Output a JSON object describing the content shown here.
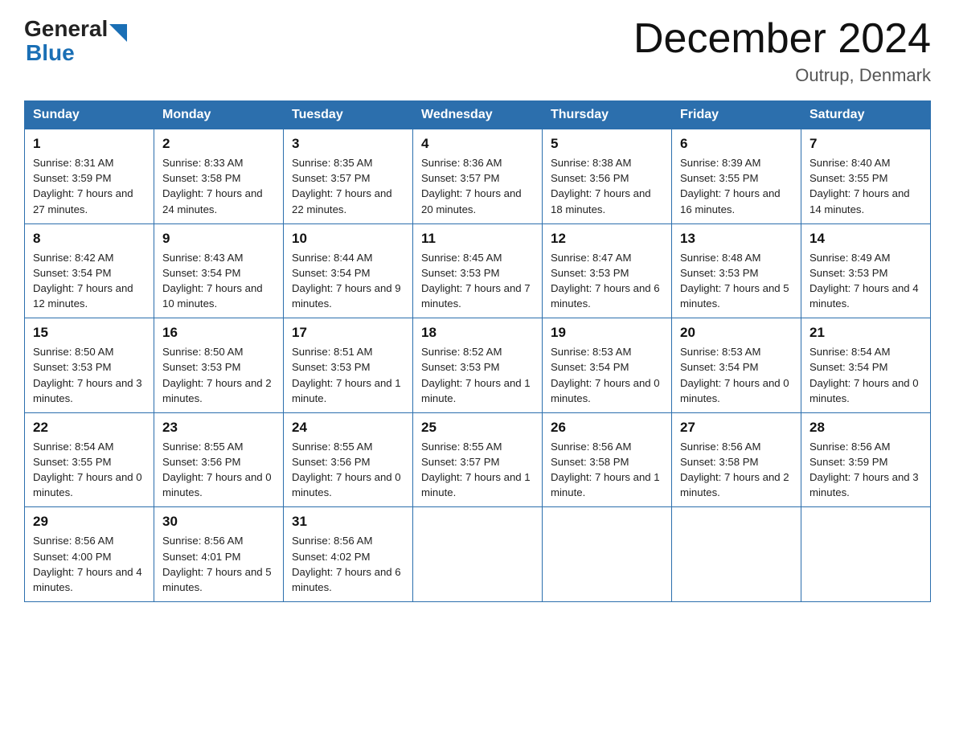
{
  "header": {
    "logo_general": "General",
    "logo_blue": "Blue",
    "month_title": "December 2024",
    "location": "Outrup, Denmark"
  },
  "weekdays": [
    "Sunday",
    "Monday",
    "Tuesday",
    "Wednesday",
    "Thursday",
    "Friday",
    "Saturday"
  ],
  "weeks": [
    [
      {
        "day": "1",
        "sunrise": "8:31 AM",
        "sunset": "3:59 PM",
        "daylight": "7 hours and 27 minutes."
      },
      {
        "day": "2",
        "sunrise": "8:33 AM",
        "sunset": "3:58 PM",
        "daylight": "7 hours and 24 minutes."
      },
      {
        "day": "3",
        "sunrise": "8:35 AM",
        "sunset": "3:57 PM",
        "daylight": "7 hours and 22 minutes."
      },
      {
        "day": "4",
        "sunrise": "8:36 AM",
        "sunset": "3:57 PM",
        "daylight": "7 hours and 20 minutes."
      },
      {
        "day": "5",
        "sunrise": "8:38 AM",
        "sunset": "3:56 PM",
        "daylight": "7 hours and 18 minutes."
      },
      {
        "day": "6",
        "sunrise": "8:39 AM",
        "sunset": "3:55 PM",
        "daylight": "7 hours and 16 minutes."
      },
      {
        "day": "7",
        "sunrise": "8:40 AM",
        "sunset": "3:55 PM",
        "daylight": "7 hours and 14 minutes."
      }
    ],
    [
      {
        "day": "8",
        "sunrise": "8:42 AM",
        "sunset": "3:54 PM",
        "daylight": "7 hours and 12 minutes."
      },
      {
        "day": "9",
        "sunrise": "8:43 AM",
        "sunset": "3:54 PM",
        "daylight": "7 hours and 10 minutes."
      },
      {
        "day": "10",
        "sunrise": "8:44 AM",
        "sunset": "3:54 PM",
        "daylight": "7 hours and 9 minutes."
      },
      {
        "day": "11",
        "sunrise": "8:45 AM",
        "sunset": "3:53 PM",
        "daylight": "7 hours and 7 minutes."
      },
      {
        "day": "12",
        "sunrise": "8:47 AM",
        "sunset": "3:53 PM",
        "daylight": "7 hours and 6 minutes."
      },
      {
        "day": "13",
        "sunrise": "8:48 AM",
        "sunset": "3:53 PM",
        "daylight": "7 hours and 5 minutes."
      },
      {
        "day": "14",
        "sunrise": "8:49 AM",
        "sunset": "3:53 PM",
        "daylight": "7 hours and 4 minutes."
      }
    ],
    [
      {
        "day": "15",
        "sunrise": "8:50 AM",
        "sunset": "3:53 PM",
        "daylight": "7 hours and 3 minutes."
      },
      {
        "day": "16",
        "sunrise": "8:50 AM",
        "sunset": "3:53 PM",
        "daylight": "7 hours and 2 minutes."
      },
      {
        "day": "17",
        "sunrise": "8:51 AM",
        "sunset": "3:53 PM",
        "daylight": "7 hours and 1 minute."
      },
      {
        "day": "18",
        "sunrise": "8:52 AM",
        "sunset": "3:53 PM",
        "daylight": "7 hours and 1 minute."
      },
      {
        "day": "19",
        "sunrise": "8:53 AM",
        "sunset": "3:54 PM",
        "daylight": "7 hours and 0 minutes."
      },
      {
        "day": "20",
        "sunrise": "8:53 AM",
        "sunset": "3:54 PM",
        "daylight": "7 hours and 0 minutes."
      },
      {
        "day": "21",
        "sunrise": "8:54 AM",
        "sunset": "3:54 PM",
        "daylight": "7 hours and 0 minutes."
      }
    ],
    [
      {
        "day": "22",
        "sunrise": "8:54 AM",
        "sunset": "3:55 PM",
        "daylight": "7 hours and 0 minutes."
      },
      {
        "day": "23",
        "sunrise": "8:55 AM",
        "sunset": "3:56 PM",
        "daylight": "7 hours and 0 minutes."
      },
      {
        "day": "24",
        "sunrise": "8:55 AM",
        "sunset": "3:56 PM",
        "daylight": "7 hours and 0 minutes."
      },
      {
        "day": "25",
        "sunrise": "8:55 AM",
        "sunset": "3:57 PM",
        "daylight": "7 hours and 1 minute."
      },
      {
        "day": "26",
        "sunrise": "8:56 AM",
        "sunset": "3:58 PM",
        "daylight": "7 hours and 1 minute."
      },
      {
        "day": "27",
        "sunrise": "8:56 AM",
        "sunset": "3:58 PM",
        "daylight": "7 hours and 2 minutes."
      },
      {
        "day": "28",
        "sunrise": "8:56 AM",
        "sunset": "3:59 PM",
        "daylight": "7 hours and 3 minutes."
      }
    ],
    [
      {
        "day": "29",
        "sunrise": "8:56 AM",
        "sunset": "4:00 PM",
        "daylight": "7 hours and 4 minutes."
      },
      {
        "day": "30",
        "sunrise": "8:56 AM",
        "sunset": "4:01 PM",
        "daylight": "7 hours and 5 minutes."
      },
      {
        "day": "31",
        "sunrise": "8:56 AM",
        "sunset": "4:02 PM",
        "daylight": "7 hours and 6 minutes."
      },
      null,
      null,
      null,
      null
    ]
  ]
}
